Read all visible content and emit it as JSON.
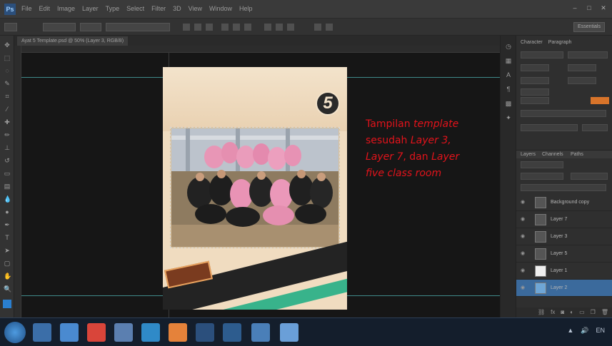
{
  "app": {
    "logo": "Ps"
  },
  "menu": [
    "File",
    "Edit",
    "Image",
    "Layer",
    "Type",
    "Select",
    "Filter",
    "3D",
    "View",
    "Window",
    "Help"
  ],
  "window_controls": [
    "–",
    "□",
    "✕"
  ],
  "options_bar": {
    "workspace": "Essentials"
  },
  "document": {
    "tab_title": "Ayat 5 Template.psd @ 50% (Layer 3, RGB/8)",
    "badge_number": "5"
  },
  "annotation": {
    "line1_prefix": "Tampilan ",
    "line1_em": "template",
    "line2_prefix": "sesudah ",
    "line2_em": "Layer 3,",
    "line3_em": "Layer 7",
    "line3_mid": ", dan ",
    "line3_em2": "Layer",
    "line4_em": "five class room"
  },
  "panels": {
    "tabs": [
      "Character",
      "Paragraph"
    ],
    "layers_tabs": [
      "Layers",
      "Channels",
      "Paths"
    ]
  },
  "layers": [
    {
      "name": "Background copy",
      "thumb": "dark",
      "selected": false
    },
    {
      "name": "Layer 7",
      "thumb": "dark",
      "selected": false
    },
    {
      "name": "Layer 3",
      "thumb": "dark",
      "selected": false
    },
    {
      "name": "Layer 5",
      "thumb": "dark",
      "selected": false
    },
    {
      "name": "Layer 1",
      "thumb": "white",
      "selected": false
    },
    {
      "name": "Layer 2",
      "thumb": "blue",
      "selected": true
    }
  ],
  "colors": {
    "annotation": "#e3131b",
    "guide": "#3f8a8a",
    "accent_green": "#38b38b",
    "swatch": "#d8742a",
    "selected_layer": "#3b6a9c"
  },
  "taskbar": {
    "apps": [
      "explorer",
      "media",
      "chrome",
      "gmail",
      "vlc",
      "office",
      "photoshop-1",
      "photoshop-2",
      "folder",
      "paint"
    ],
    "tray": [
      "▲",
      "🔊",
      "EN"
    ]
  }
}
